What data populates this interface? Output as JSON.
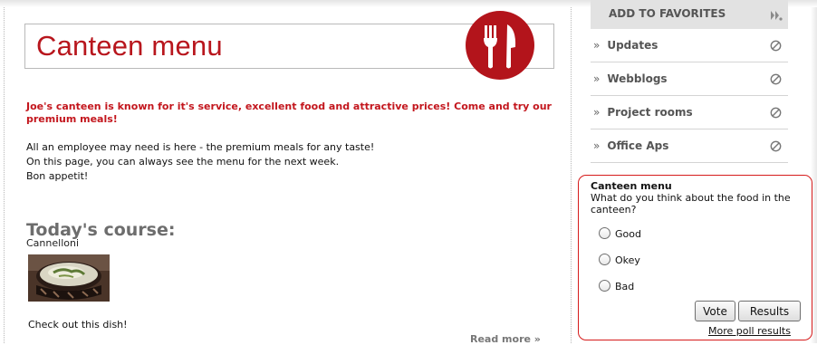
{
  "title": "Canteen menu",
  "intro": "Joe's canteen is known for it's service, excellent food and attractive prices! Come and try our premium meals!",
  "body_lines": [
    "All an employee may need is here - the premium meals for any taste!",
    "On this page, you can always see the menu for the next week.",
    "Bon appetit!"
  ],
  "course": {
    "heading": "Today's course:",
    "name": "Cannelloni",
    "note": "Check out this dish!",
    "read_more": "Read more »"
  },
  "sidebar": {
    "favorites_label": "ADD TO FAVORITES",
    "raquo": "»",
    "items": [
      {
        "label": "Updates"
      },
      {
        "label": "Webblogs"
      },
      {
        "label": "Project rooms"
      },
      {
        "label": "Office Aps"
      }
    ]
  },
  "poll": {
    "title": "Canteen menu",
    "question": "What do you think about the food in the canteen?",
    "options": [
      "Good",
      "Okey",
      "Bad"
    ],
    "vote_label": "Vote",
    "results_label": "Results",
    "more_link": "More poll results"
  },
  "colors": {
    "brand_red": "#b8161d",
    "poll_border": "#d61b1b"
  }
}
